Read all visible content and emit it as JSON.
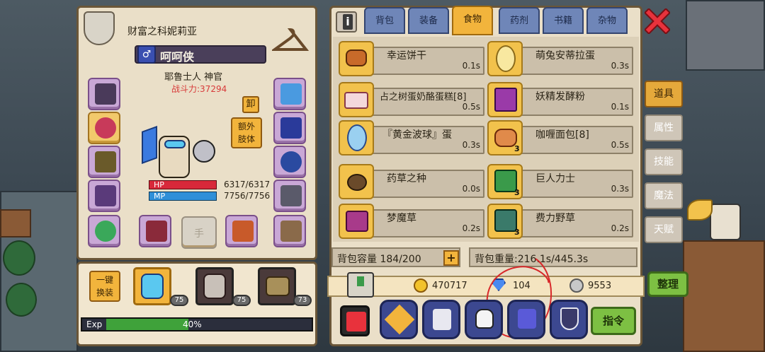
{
  "character": {
    "title": "财富之科妮莉亚",
    "name": "呵呵侠",
    "class": "耶鲁士人 神官",
    "power": "战斗力:37294",
    "unequip_label": "卸",
    "extra_body_label": "额外\n肢体",
    "hand_slot_label": "手",
    "hp_label": "HP",
    "hp_value": "6317/6317",
    "mp_label": "MP",
    "mp_value": "7756/7756"
  },
  "team": {
    "quick_equip_label": "一键\n换装",
    "members": [
      {
        "level": "75",
        "icon": "diver-hero"
      },
      {
        "level": "75",
        "icon": "masked-hero"
      },
      {
        "level": "73",
        "icon": "goblin-hero"
      }
    ],
    "exp_label": "Exp",
    "exp_percent": "40%",
    "exp_fraction": 0.4
  },
  "tabs": [
    {
      "label": "背包",
      "active": false
    },
    {
      "label": "装备",
      "active": false
    },
    {
      "label": "食物",
      "active": true
    },
    {
      "label": "药剂",
      "active": false
    },
    {
      "label": "书籍",
      "active": false
    },
    {
      "label": "杂物",
      "active": false
    }
  ],
  "items": [
    {
      "name": "幸运饼干",
      "time": "0.1s",
      "qty": "",
      "icon": "cookie-icon"
    },
    {
      "name": "萌兔安蒂拉蛋",
      "time": "0.3s",
      "qty": "",
      "icon": "bunny-egg-icon"
    },
    {
      "name": "占之树蛋奶酪蛋糕[8]",
      "time": "0.5s",
      "qty": "",
      "icon": "cake-icon"
    },
    {
      "name": "妖精发酵粉",
      "time": "0.1s",
      "qty": "",
      "icon": "powder-icon"
    },
    {
      "name": "『黄金波球』蛋",
      "time": "0.3s",
      "qty": "",
      "icon": "blue-egg-icon"
    },
    {
      "name": "咖喱面包[8]",
      "time": "0.5s",
      "qty": "3",
      "icon": "bread-icon"
    },
    {
      "name": "药草之种",
      "time": "0.0s",
      "qty": "",
      "icon": "seed-icon"
    },
    {
      "name": "巨人力士",
      "time": "0.3s",
      "qty": "3",
      "icon": "herb-icon"
    },
    {
      "name": "梦魔草",
      "time": "0.2s",
      "qty": "",
      "icon": "grass-icon"
    },
    {
      "name": "费力野草",
      "time": "0.2s",
      "qty": "3",
      "icon": "weed-icon"
    }
  ],
  "bag": {
    "capacity": "背包容量 184/200",
    "weight": "背包重量:216.1s/445.3s"
  },
  "currency": {
    "gold": "470717",
    "gems": "104",
    "silver": "9553"
  },
  "side_tabs": [
    {
      "label": "道具",
      "active": true
    },
    {
      "label": "属性",
      "active": false
    },
    {
      "label": "技能",
      "active": false
    },
    {
      "label": "魔法",
      "active": false
    },
    {
      "label": "天赋",
      "active": false
    }
  ],
  "buttons": {
    "sort": "整理",
    "command": "指令",
    "info": "i"
  },
  "colors": {
    "hp": "#d8283a",
    "mp": "#2f8fd8",
    "exp": "#3fa23a",
    "power": "#d83a3a"
  }
}
